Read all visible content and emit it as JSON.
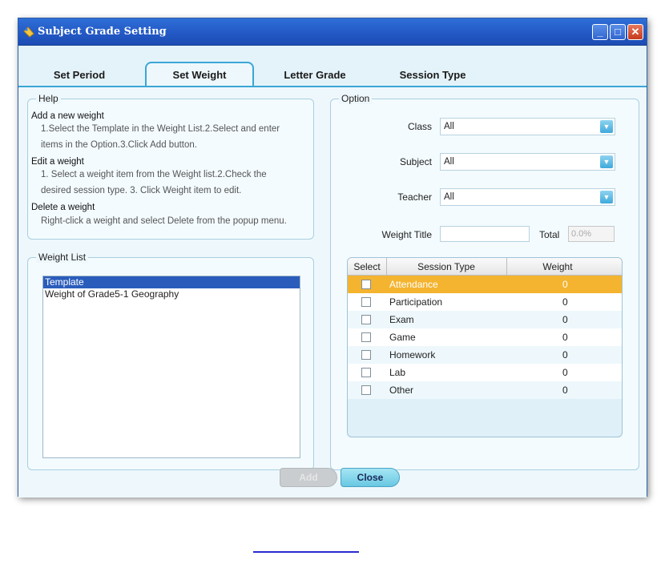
{
  "window": {
    "title": "Subject Grade Setting",
    "min_label": "_",
    "max_label": "□",
    "close_label": "✕"
  },
  "tabs": [
    {
      "label": "Set Period",
      "active": false
    },
    {
      "label": "Set Weight",
      "active": true
    },
    {
      "label": "Letter Grade",
      "active": false
    },
    {
      "label": "Session Type",
      "active": false
    }
  ],
  "help": {
    "legend": "Help",
    "lines": [
      "Add a new weight",
      "1.Select the Template in the Weight List.2.Select and enter",
      "items in the Option.3.Click Add button.",
      "Edit a weight",
      "1. Select a weight item from the Weight list.2.Check the",
      "desired session type. 3. Click Weight item to edit.",
      "Delete a weight",
      "Right-click a weight and select Delete from the popup menu."
    ]
  },
  "weight_list": {
    "legend": "Weight List",
    "items": [
      "Template",
      "Weight of Grade5-1 Geography"
    ],
    "selected_index": 0
  },
  "option": {
    "legend": "Option",
    "class_label": "Class",
    "class_value": "All",
    "subject_label": "Subject",
    "subject_value": "All",
    "teacher_label": "Teacher",
    "teacher_value": "All",
    "weight_title_label": "Weight Title",
    "weight_title_value": "",
    "total_label": "Total",
    "total_value": "0.0%"
  },
  "grid": {
    "headers": [
      "Select",
      "Session Type",
      "Weight"
    ],
    "rows": [
      {
        "type": "Attendance",
        "weight": "0",
        "highlighted": true
      },
      {
        "type": "Participation",
        "weight": "0",
        "highlighted": false
      },
      {
        "type": "Exam",
        "weight": "0",
        "highlighted": false
      },
      {
        "type": "Game",
        "weight": "0",
        "highlighted": false
      },
      {
        "type": "Homework",
        "weight": "0",
        "highlighted": false
      },
      {
        "type": "Lab",
        "weight": "0",
        "highlighted": false
      },
      {
        "type": "Other",
        "weight": "0",
        "highlighted": false
      }
    ]
  },
  "buttons": {
    "add_label": "Add",
    "close_label": "Close"
  }
}
